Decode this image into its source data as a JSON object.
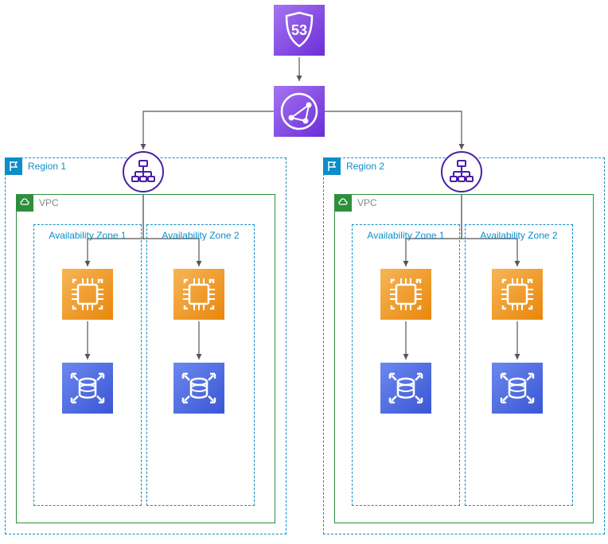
{
  "top": {
    "route53_label": "53"
  },
  "regions": [
    {
      "label": "Region 1",
      "vpc_label": "VPC",
      "zones": [
        {
          "label": "Availability Zone 1"
        },
        {
          "label": "Availability Zone 2"
        }
      ]
    },
    {
      "label": "Region 2",
      "vpc_label": "VPC",
      "zones": [
        {
          "label": "Availability Zone 1"
        },
        {
          "label": "Availability Zone 2"
        }
      ]
    }
  ],
  "icons": {
    "route53": "route53-icon",
    "cloudfront": "cloudfront-icon",
    "elb": "elb-icon",
    "ec2": "ec2-icon",
    "dynamodb": "dynamodb-icon"
  },
  "colors": {
    "purple_light": "#a674f2",
    "purple_dark": "#6b2ed6",
    "purple_border": "#4a1fa8",
    "orange_light": "#f5a623",
    "orange_dark": "#e8870c",
    "blue_light": "#5b7be8",
    "blue_dark": "#3a56d4",
    "region_blue": "#0d8dc9",
    "vpc_green": "#2d8f3c"
  }
}
